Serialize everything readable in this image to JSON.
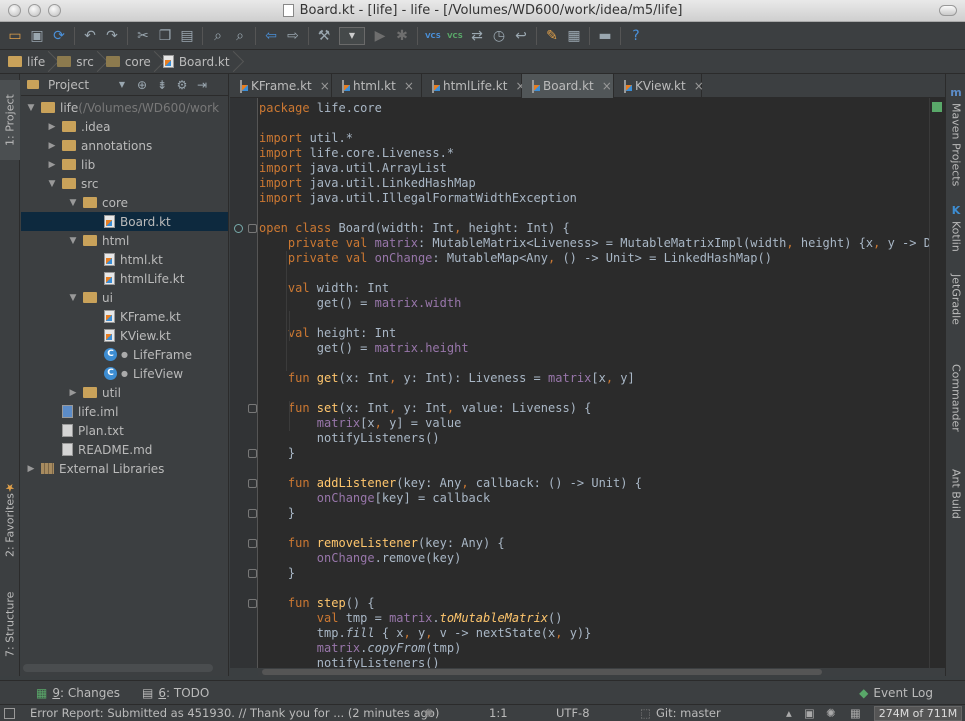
{
  "window": {
    "title": "Board.kt - [life] - life - [/Volumes/WD600/work/idea/m5/life]"
  },
  "toolbar": {
    "icons": [
      "open-icon",
      "save-icon",
      "sync-icon",
      "undo-icon",
      "redo-icon",
      "cut-icon",
      "copy-icon",
      "paste-icon",
      "find-icon",
      "replace-icon",
      "back-icon",
      "forward-icon",
      "build-icon",
      "run-config-combo",
      "run-icon",
      "debug-icon",
      "vcs-update-icon",
      "vcs-commit-icon",
      "vcs-compare-icon",
      "vcs-history-icon",
      "revert-icon",
      "settings-icon",
      "project-structure-icon",
      "sdk-icon",
      "help-icon"
    ],
    "vcs_label": "VCS"
  },
  "breadcrumbs": [
    "life",
    "src",
    "core",
    "Board.kt"
  ],
  "left_strip": {
    "project": "1: Project",
    "favorites": "2: Favorites",
    "structure": "7: Structure"
  },
  "right_strip": {
    "maven": "Maven Projects",
    "kotlin": "Kotlin",
    "jetgradle": "JetGradle",
    "commander": "Commander",
    "ant": "Ant Build",
    "maven_icon": "m",
    "kotlin_icon": "K"
  },
  "project_panel": {
    "header": "Project"
  },
  "tree": [
    {
      "label": "life",
      "extra": " (/Volumes/WD600/work",
      "type": "folder",
      "depth": 0,
      "arrow": "▼"
    },
    {
      "label": ".idea",
      "type": "folder",
      "depth": 1,
      "arrow": "▶"
    },
    {
      "label": "annotations",
      "type": "folder",
      "depth": 1,
      "arrow": "▶"
    },
    {
      "label": "lib",
      "type": "folder",
      "depth": 1,
      "arrow": "▶"
    },
    {
      "label": "src",
      "type": "folder",
      "depth": 1,
      "arrow": "▼"
    },
    {
      "label": "core",
      "type": "folder",
      "depth": 2,
      "arrow": "▼"
    },
    {
      "label": "Board.kt",
      "type": "kt",
      "depth": 3,
      "arrow": "",
      "selected": true
    },
    {
      "label": "html",
      "type": "folder",
      "depth": 2,
      "arrow": "▼"
    },
    {
      "label": "html.kt",
      "type": "kt",
      "depth": 3,
      "arrow": ""
    },
    {
      "label": "htmlLife.kt",
      "type": "kt",
      "depth": 3,
      "arrow": ""
    },
    {
      "label": "ui",
      "type": "folder",
      "depth": 2,
      "arrow": "▼"
    },
    {
      "label": "KFrame.kt",
      "type": "kt",
      "depth": 3,
      "arrow": ""
    },
    {
      "label": "KView.kt",
      "type": "kt",
      "depth": 3,
      "arrow": ""
    },
    {
      "label": "LifeFrame",
      "type": "class",
      "depth": 3,
      "arrow": ""
    },
    {
      "label": "LifeView",
      "type": "class",
      "depth": 3,
      "arrow": ""
    },
    {
      "label": "util",
      "type": "folder",
      "depth": 2,
      "arrow": "▶"
    },
    {
      "label": "life.iml",
      "type": "iml",
      "depth": 1,
      "arrow": ""
    },
    {
      "label": "Plan.txt",
      "type": "file",
      "depth": 1,
      "arrow": ""
    },
    {
      "label": "README.md",
      "type": "file",
      "depth": 1,
      "arrow": ""
    },
    {
      "label": "External Libraries",
      "type": "libs",
      "depth": 0,
      "arrow": "▶"
    }
  ],
  "tabs": [
    {
      "label": "KFrame.kt",
      "active": false
    },
    {
      "label": "html.kt",
      "active": false
    },
    {
      "label": "htmlLife.kt",
      "active": false
    },
    {
      "label": "Board.kt",
      "active": true
    },
    {
      "label": "KView.kt",
      "active": false
    }
  ],
  "code_lines": [
    [
      [
        "package ",
        "k"
      ],
      [
        "life.core",
        ""
      ]
    ],
    [],
    [
      [
        "import ",
        "k"
      ],
      [
        "util.*",
        ""
      ]
    ],
    [
      [
        "import ",
        "k"
      ],
      [
        "life.core.Liveness.*",
        ""
      ]
    ],
    [
      [
        "import ",
        "k"
      ],
      [
        "java.util.ArrayList",
        ""
      ]
    ],
    [
      [
        "import ",
        "k"
      ],
      [
        "java.util.LinkedHashMap",
        ""
      ]
    ],
    [
      [
        "import ",
        "k"
      ],
      [
        "java.util.IllegalFormatWidthException",
        ""
      ]
    ],
    [],
    [
      [
        "open class ",
        "k"
      ],
      [
        "Board(width: Int",
        ""
      ],
      [
        ", ",
        "k"
      ],
      [
        "height: Int) {",
        ""
      ]
    ],
    [
      [
        "    private val ",
        "k"
      ],
      [
        "matrix",
        "p"
      ],
      [
        ": MutableMatrix<Liveness> = MutableMatrixImpl(width",
        ""
      ],
      [
        ", ",
        "k"
      ],
      [
        "height) {x",
        ""
      ],
      [
        ", ",
        "k"
      ],
      [
        "y -> DEA",
        ""
      ]
    ],
    [
      [
        "    private val ",
        "k"
      ],
      [
        "onChange",
        "p"
      ],
      [
        ": MutableMap<Any",
        ""
      ],
      [
        ", ",
        "k"
      ],
      [
        "() -> Unit> = LinkedHashMap()",
        ""
      ]
    ],
    [],
    [
      [
        "    val ",
        "k"
      ],
      [
        "width",
        ""
      ],
      [
        ": Int",
        ""
      ]
    ],
    [
      [
        "        get",
        "f0"
      ],
      [
        "() = ",
        ""
      ],
      [
        "matrix",
        "p"
      ],
      [
        ".width",
        "p"
      ]
    ],
    [],
    [
      [
        "    val ",
        "k"
      ],
      [
        "height",
        ""
      ],
      [
        ": Int",
        ""
      ]
    ],
    [
      [
        "        get",
        "f0"
      ],
      [
        "() = ",
        ""
      ],
      [
        "matrix",
        "p"
      ],
      [
        ".height",
        "p"
      ]
    ],
    [],
    [
      [
        "    fun ",
        "k"
      ],
      [
        "get",
        "f"
      ],
      [
        "(x: Int",
        ""
      ],
      [
        ", ",
        "k"
      ],
      [
        "y: Int): Liveness = ",
        ""
      ],
      [
        "matrix",
        "p"
      ],
      [
        "[x",
        ""
      ],
      [
        ", ",
        "k"
      ],
      [
        "y]",
        ""
      ]
    ],
    [],
    [
      [
        "    fun ",
        "k"
      ],
      [
        "set",
        "f"
      ],
      [
        "(x: Int",
        ""
      ],
      [
        ", ",
        "k"
      ],
      [
        "y: Int",
        ""
      ],
      [
        ", ",
        "k"
      ],
      [
        "value: Liveness) {",
        ""
      ]
    ],
    [
      [
        "        matrix",
        "p"
      ],
      [
        "[x",
        ""
      ],
      [
        ", ",
        "k"
      ],
      [
        "y] = value",
        ""
      ]
    ],
    [
      [
        "        notifyListeners()",
        ""
      ]
    ],
    [
      [
        "    }",
        ""
      ]
    ],
    [],
    [
      [
        "    fun ",
        "k"
      ],
      [
        "addListener",
        "f"
      ],
      [
        "(key: Any",
        ""
      ],
      [
        ", ",
        "k"
      ],
      [
        "callback: () -> Unit) {",
        ""
      ]
    ],
    [
      [
        "        onChange",
        "p"
      ],
      [
        "[key] = callback",
        ""
      ]
    ],
    [
      [
        "    }",
        ""
      ]
    ],
    [],
    [
      [
        "    fun ",
        "k"
      ],
      [
        "removeListener",
        "f"
      ],
      [
        "(key: Any) {",
        ""
      ]
    ],
    [
      [
        "        onChange",
        "p"
      ],
      [
        ".remove(key)",
        ""
      ]
    ],
    [
      [
        "    }",
        ""
      ]
    ],
    [],
    [
      [
        "    fun ",
        "k"
      ],
      [
        "step",
        "f"
      ],
      [
        "() {",
        ""
      ]
    ],
    [
      [
        "        val ",
        "k"
      ],
      [
        "tmp = ",
        ""
      ],
      [
        "matrix",
        "p"
      ],
      [
        ".",
        ""
      ],
      [
        "toMutableMatrix",
        "fi"
      ],
      [
        "()",
        ""
      ]
    ],
    [
      [
        "        tmp.",
        ""
      ],
      [
        "fill",
        "i"
      ],
      [
        " { x",
        ""
      ],
      [
        ", ",
        "k"
      ],
      [
        "y",
        ""
      ],
      [
        ", ",
        "k"
      ],
      [
        "v -> nextState(x",
        ""
      ],
      [
        ", ",
        "k"
      ],
      [
        "y)}",
        ""
      ]
    ],
    [
      [
        "        matrix",
        "p"
      ],
      [
        ".",
        ""
      ],
      [
        "copyFrom",
        "i"
      ],
      [
        "(tmp)",
        ""
      ]
    ],
    [
      [
        "        notifyListeners()",
        ""
      ]
    ]
  ],
  "bottom_tools": [
    {
      "num": "9",
      "label": ": Changes"
    },
    {
      "num": "6",
      "label": ": TODO"
    }
  ],
  "event_log": "Event Log",
  "status": {
    "message": "Error Report: Submitted as 451930. // Thank you for ... (2 minutes ago)",
    "position": "1:1",
    "encoding": "UTF-8",
    "git": "Git: master",
    "memory": "274M of 711M"
  },
  "colors": {
    "keyword": "#cc7832",
    "property": "#9876aa",
    "function": "#ffc66d",
    "text": "#a9b7c6",
    "editor_bg": "#2b2b2b",
    "panel_bg": "#3c3f41",
    "selection": "#0d293e"
  }
}
